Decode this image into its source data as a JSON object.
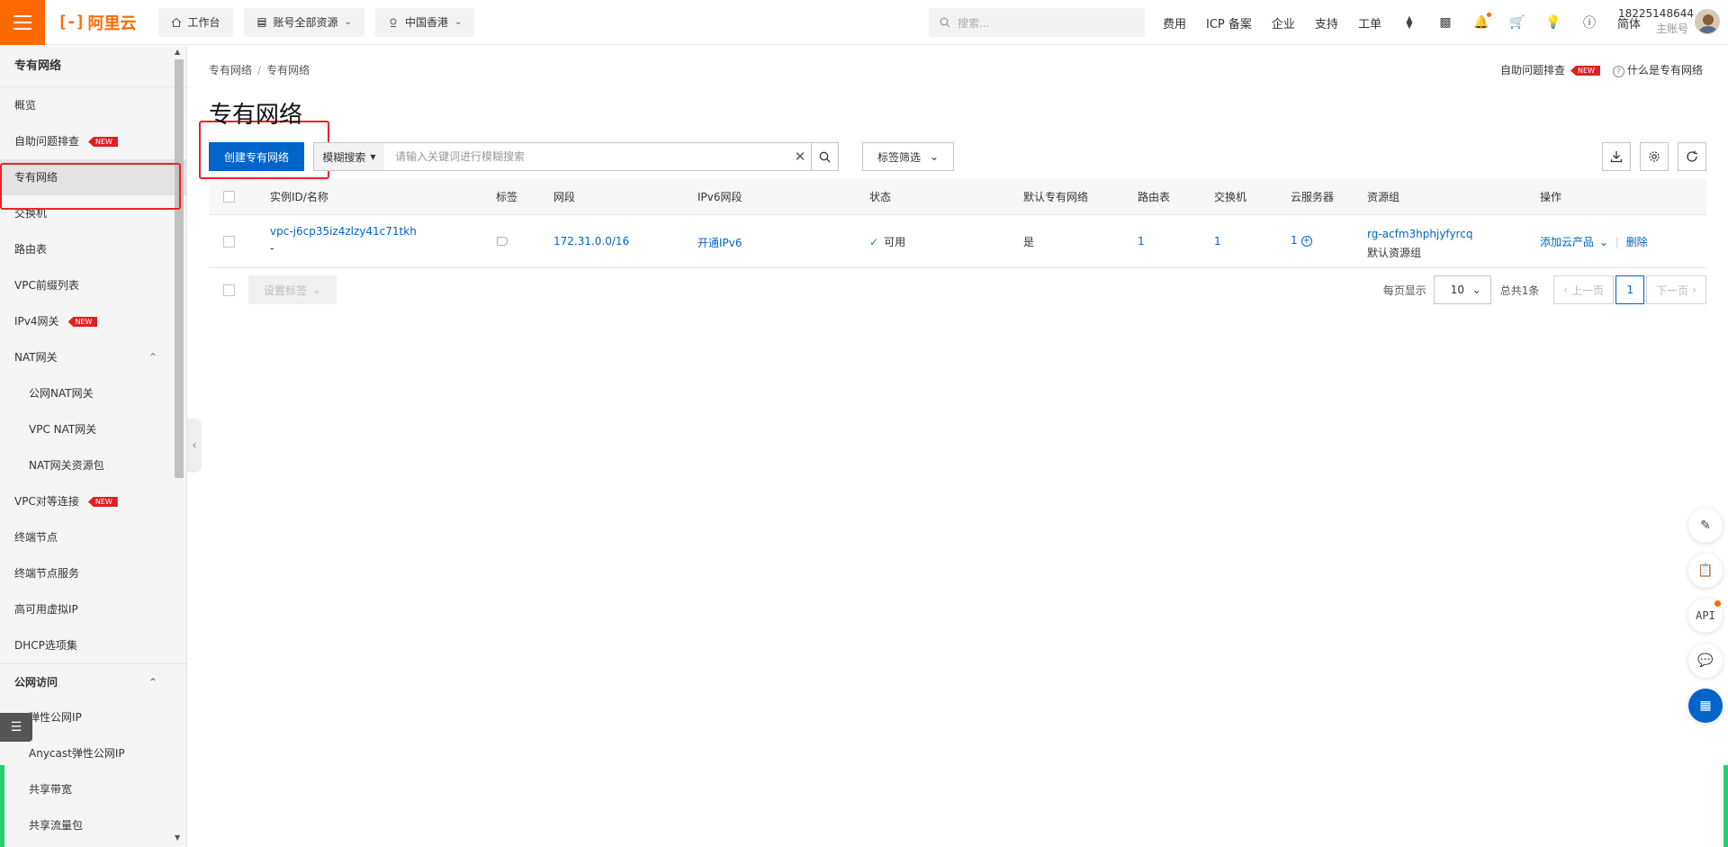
{
  "topbar": {
    "logo_text": "阿里云",
    "workbench": "工作台",
    "resources": "账号全部资源",
    "region": "中国香港",
    "search_placeholder": "搜索...",
    "links": [
      "费用",
      "ICP 备案",
      "企业",
      "支持",
      "工单"
    ],
    "lang": "简体",
    "user_name": "18225148644",
    "user_role": "主账号"
  },
  "sidebar": {
    "title": "专有网络",
    "items": [
      {
        "label": "概览"
      },
      {
        "label": "自助问题排查",
        "badge": "NEW"
      },
      {
        "label": "专有网络"
      },
      {
        "label": "交换机"
      },
      {
        "label": "路由表"
      },
      {
        "label": "VPC前缀列表"
      },
      {
        "label": "IPv4网关",
        "badge": "NEW"
      },
      {
        "label": "NAT网关"
      },
      {
        "label": "公网NAT网关"
      },
      {
        "label": "VPC NAT网关"
      },
      {
        "label": "NAT网关资源包"
      },
      {
        "label": "VPC对等连接",
        "badge": "NEW"
      },
      {
        "label": "终端节点"
      },
      {
        "label": "终端节点服务"
      },
      {
        "label": "高可用虚拟IP"
      },
      {
        "label": "DHCP选项集"
      },
      {
        "label": "公网访问"
      },
      {
        "label": "弹性公网IP"
      },
      {
        "label": "Anycast弹性公网IP"
      },
      {
        "label": "共享带宽"
      },
      {
        "label": "共享流量包"
      }
    ]
  },
  "main": {
    "breadcrumb": [
      "专有网络",
      "专有网络"
    ],
    "title": "专有网络",
    "help_troubleshoot": "自助问题排查",
    "help_badge": "NEW",
    "help_what": "什么是专有网络",
    "create_button": "创建专有网络",
    "search_mode": "模糊搜索",
    "search_placeholder": "请输入关键词进行模糊搜索",
    "tag_filter": "标签筛选"
  },
  "table": {
    "headers": [
      "实例ID/名称",
      "标签",
      "网段",
      "IPv6网段",
      "状态",
      "默认专有网络",
      "路由表",
      "交换机",
      "云服务器",
      "资源组",
      "操作"
    ],
    "rows": [
      {
        "id": "vpc-j6cp35iz4zlzy41c71tkh",
        "name": "-",
        "cidr": "172.31.0.0/16",
        "ipv6": "开通IPv6",
        "status": "可用",
        "is_default": "是",
        "route_tables": "1",
        "vswitches": "1",
        "ecs": "1",
        "rg_id": "rg-acfm3hphjyfyrcq",
        "rg_name": "默认资源组",
        "action_add": "添加云产品",
        "action_delete": "删除"
      }
    ]
  },
  "footer": {
    "set_tags": "设置标签",
    "per_page_label": "每页显示",
    "per_page": "10",
    "total": "总共1条",
    "prev": "上一页",
    "current_page": "1",
    "next": "下一页"
  }
}
